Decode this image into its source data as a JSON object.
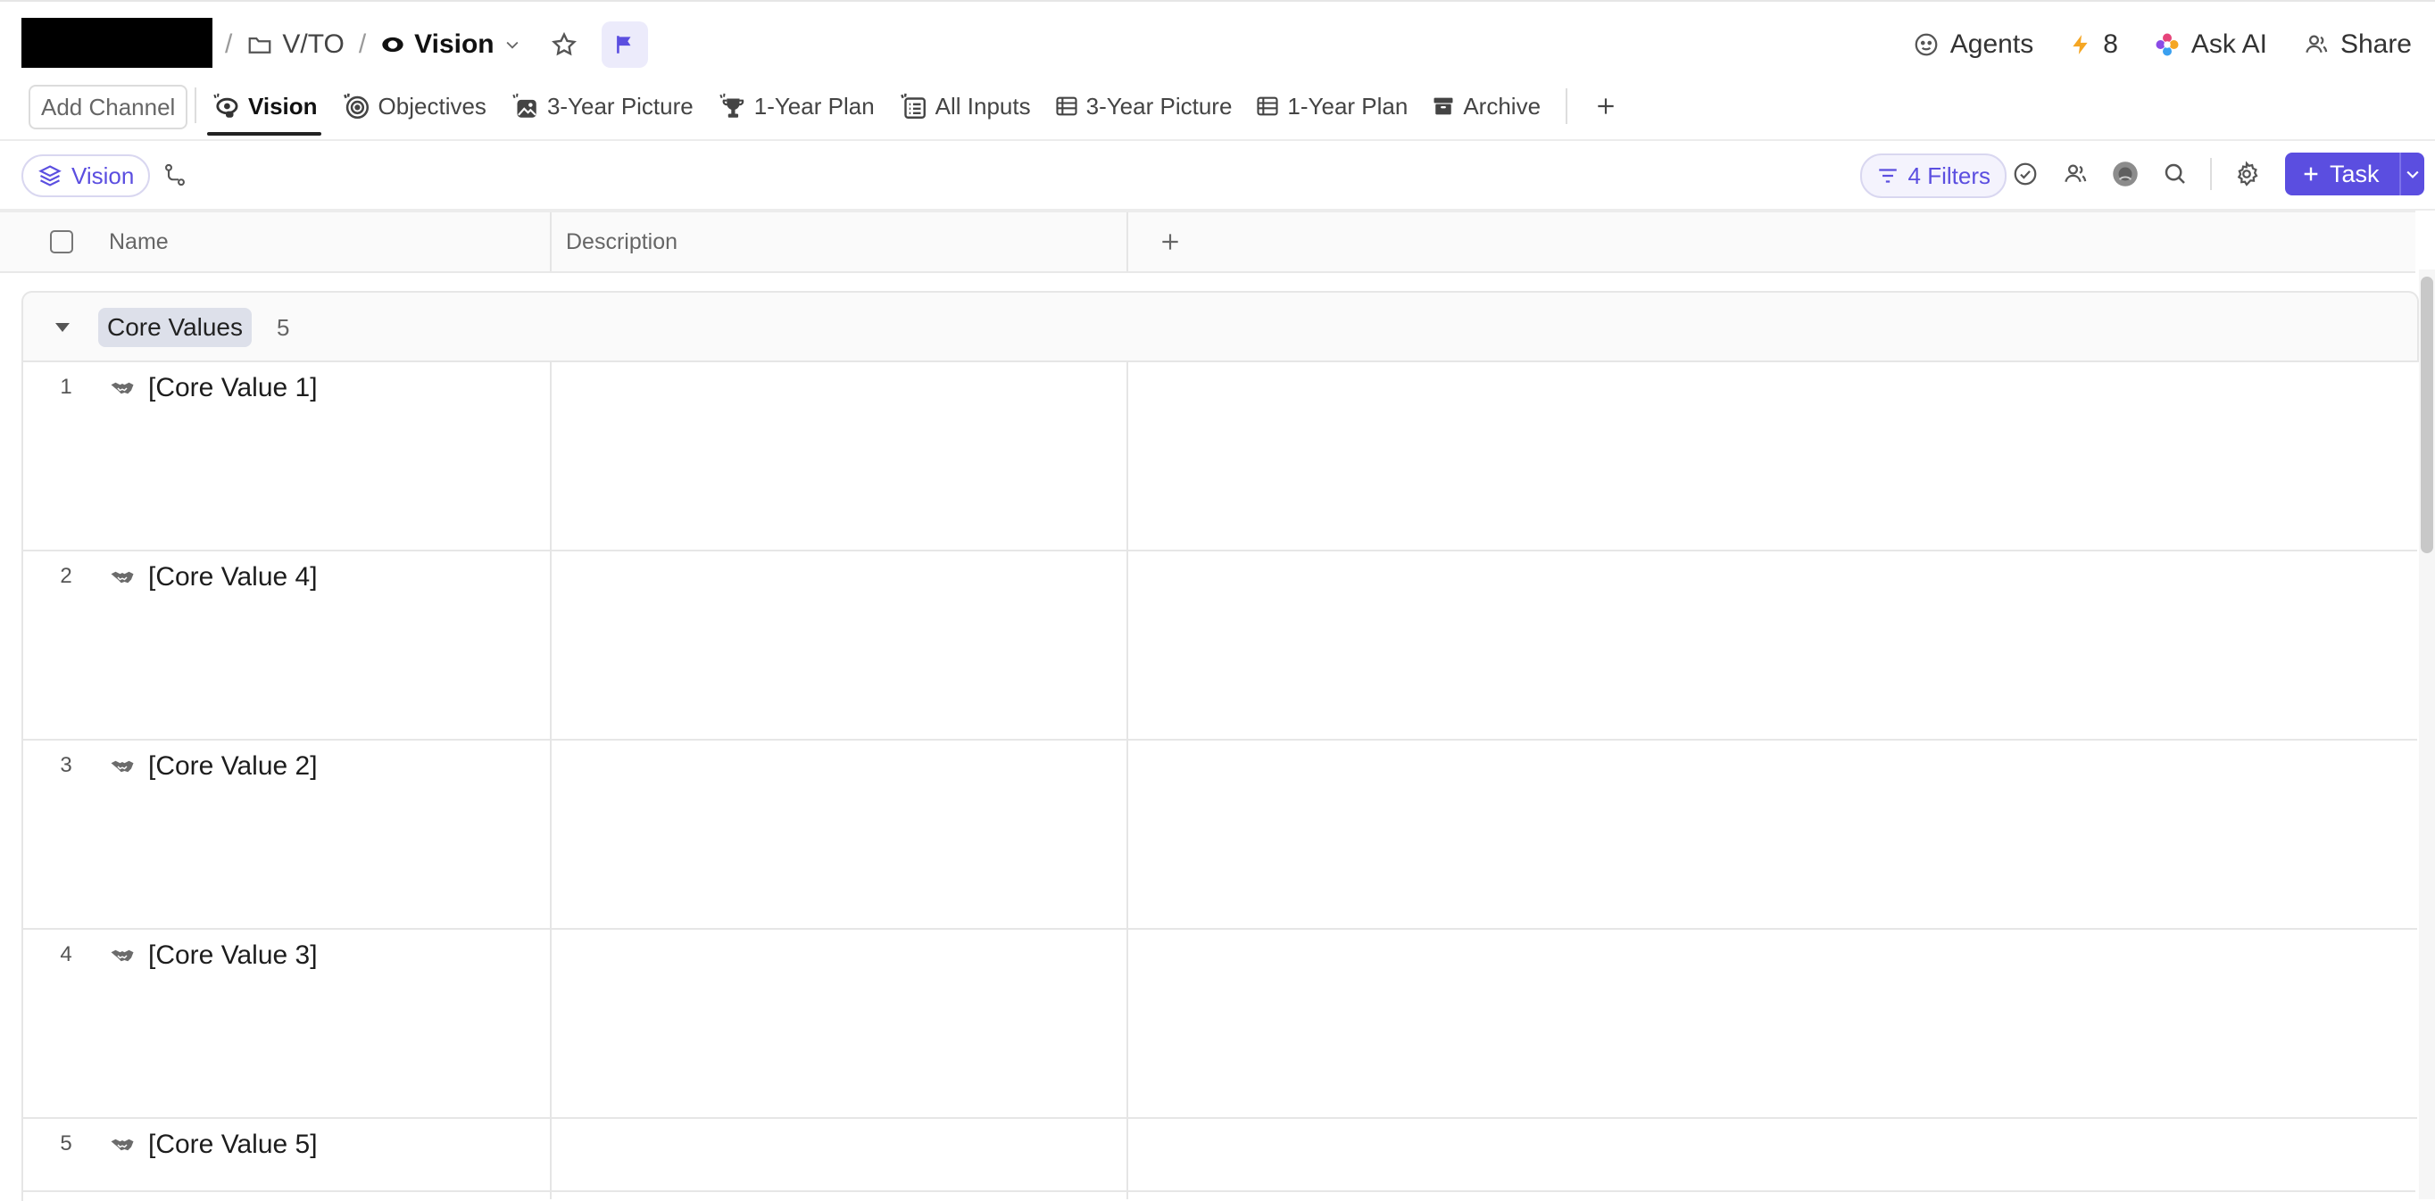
{
  "breadcrumb": {
    "separator": "/",
    "folder": "V/TO",
    "current": "Vision"
  },
  "header_actions": {
    "agents": "Agents",
    "bolt_count": "8",
    "ask_ai": "Ask AI",
    "share": "Share"
  },
  "tabs": {
    "add_channel": "Add Channel",
    "items": [
      {
        "label": "Vision",
        "icon": "eye-icon",
        "active": true
      },
      {
        "label": "Objectives",
        "icon": "target-icon"
      },
      {
        "label": "3-Year Picture",
        "icon": "image-icon"
      },
      {
        "label": "1-Year Plan",
        "icon": "trophy-icon"
      },
      {
        "label": "All Inputs",
        "icon": "form-icon"
      },
      {
        "label": "3-Year Picture",
        "icon": "table-icon"
      },
      {
        "label": "1-Year Plan",
        "icon": "table-icon"
      },
      {
        "label": "Archive",
        "icon": "archive-icon"
      }
    ]
  },
  "toolbar": {
    "view_label": "Vision",
    "filters_label": "4 Filters",
    "task_label": "Task"
  },
  "table": {
    "columns": [
      "Name",
      "Description"
    ],
    "group": {
      "label": "Core Values",
      "count": "5"
    },
    "rows": [
      {
        "num": "1",
        "name": "[Core Value 1]"
      },
      {
        "num": "2",
        "name": "[Core Value 4]"
      },
      {
        "num": "3",
        "name": "[Core Value 2]"
      },
      {
        "num": "4",
        "name": "[Core Value 3]"
      },
      {
        "num": "5",
        "name": "[Core Value 5]"
      }
    ]
  },
  "colors": {
    "accent": "#5b4ee0",
    "bolt": "#f5a623"
  }
}
